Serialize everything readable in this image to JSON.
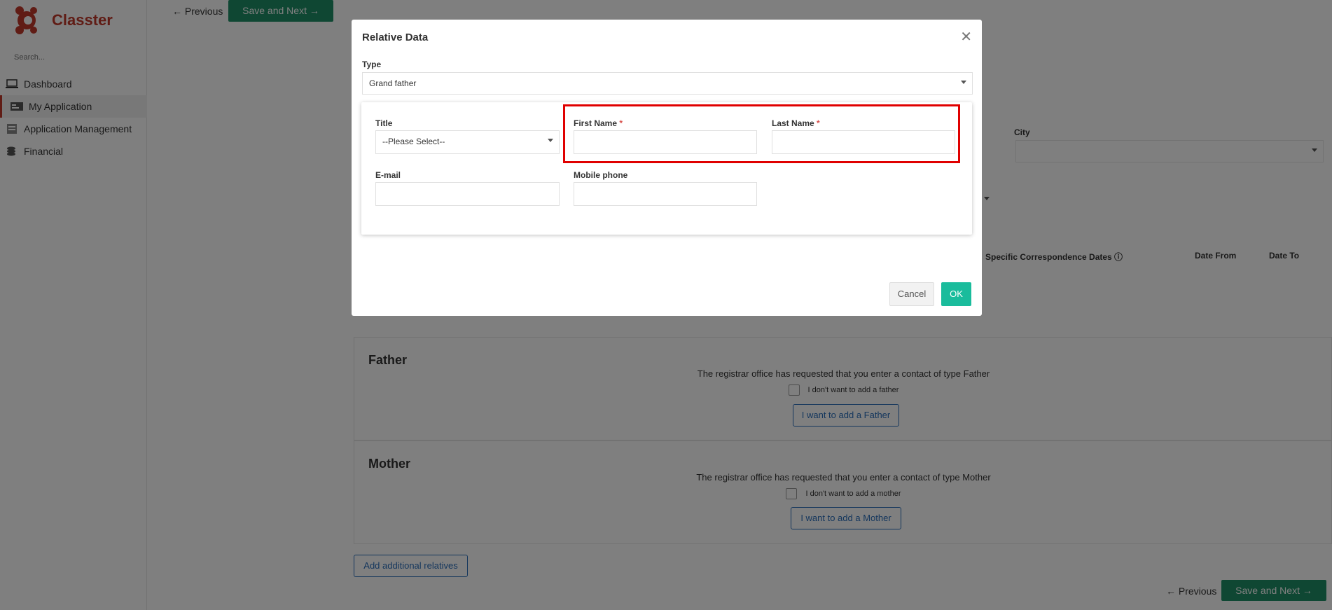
{
  "app": {
    "name": "Classter",
    "brand_color": "#c0392b"
  },
  "sidebar": {
    "search_placeholder": "Search...",
    "items": [
      {
        "label": "Dashboard",
        "icon": "laptop-icon"
      },
      {
        "label": "My Application",
        "icon": "application-icon",
        "active": true
      },
      {
        "label": "Application Management",
        "icon": "management-icon"
      },
      {
        "label": "Financial",
        "icon": "coins-icon"
      }
    ]
  },
  "topbar": {
    "previous_label": "← Previous",
    "save_next_label": "Save and Next →"
  },
  "background": {
    "city_label": "City",
    "table_headers": [
      "Specific Correspondence Dates ⓘ",
      "Date From",
      "Date To"
    ],
    "father": {
      "heading": "Father",
      "request_text": "The registrar office has requested that you enter a contact of type Father",
      "checkbox_label": "I don't want to add a father",
      "add_button": "I want to add a Father"
    },
    "mother": {
      "heading": "Mother",
      "request_text": "The registrar office has requested that you enter a contact of type Mother",
      "checkbox_label": "I don't want to add a mother",
      "add_button": "I want to add a Mother"
    },
    "add_relatives_button": "Add additional relatives",
    "bottom_previous": "← Previous",
    "bottom_save_next": "Save and Next →"
  },
  "modal": {
    "title": "Relative Data",
    "close_icon": "close-icon",
    "type_label": "Type",
    "type_value": "Grand father",
    "title_label": "Title",
    "title_value": "--Please Select--",
    "first_name_label": "First Name",
    "last_name_label": "Last Name",
    "required_mark": "*",
    "email_label": "E-mail",
    "mobile_label": "Mobile phone",
    "first_name_value": "",
    "last_name_value": "",
    "email_value": "",
    "mobile_value": "",
    "cancel_label": "Cancel",
    "ok_label": "OK",
    "highlight_color": "#e00000"
  }
}
